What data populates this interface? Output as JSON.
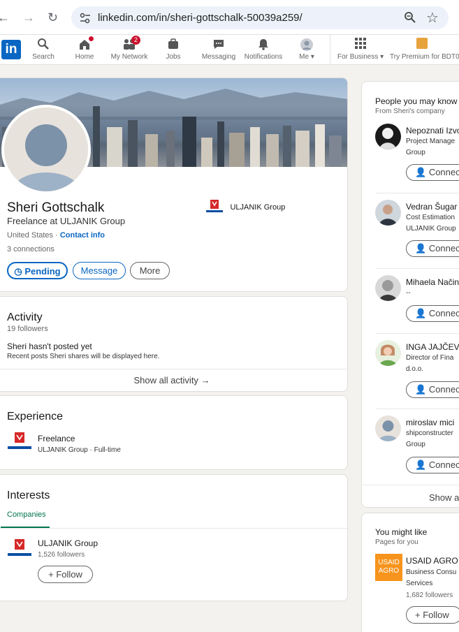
{
  "browser": {
    "url": "linkedin.com/in/sheri-gottschalk-50039a259/"
  },
  "nav": {
    "logo": "in",
    "items": [
      {
        "label": "Search",
        "icon": "search-icon"
      },
      {
        "label": "Home",
        "icon": "home-icon"
      },
      {
        "label": "My Network",
        "icon": "network-icon",
        "badge": "2"
      },
      {
        "label": "Jobs",
        "icon": "jobs-icon"
      },
      {
        "label": "Messaging",
        "icon": "messaging-icon"
      },
      {
        "label": "Notifications",
        "icon": "notifications-icon"
      },
      {
        "label": "Me",
        "icon": "me-avatar"
      },
      {
        "label": "For Business",
        "icon": "grid-icon"
      },
      {
        "label": "Try Premium for BDT0",
        "icon": "premium-icon"
      }
    ]
  },
  "profile": {
    "name": "Sheri Gottschalk",
    "headline": "Freelance at ULJANIK Group",
    "location": "United States",
    "contact_link": "Contact info",
    "connections": "3 connections",
    "company": "ULJANIK Group",
    "buttons": {
      "pending": "Pending",
      "message": "Message",
      "more": "More"
    }
  },
  "activity": {
    "title": "Activity",
    "followers": "19 followers",
    "empty_title": "Sheri hasn't posted yet",
    "empty_sub": "Recent posts Sheri shares will be displayed here.",
    "show_all": "Show all activity →"
  },
  "experience": {
    "title": "Experience",
    "items": [
      {
        "role": "Freelance",
        "company": "ULJANIK Group · Full-time"
      }
    ]
  },
  "interests": {
    "title": "Interests",
    "tab": "Companies",
    "items": [
      {
        "name": "ULJANIK Group",
        "followers": "1,526 followers",
        "button": "Follow"
      }
    ]
  },
  "pymk": {
    "title": "People you may know",
    "subtitle": "From Sheri's company",
    "connect_label": "Connect",
    "people": [
      {
        "name": "Nepoznati Izvo",
        "line1": "Project Manage",
        "line2": "Group"
      },
      {
        "name": "Vedran Šugar",
        "line1": "Cost Estimation",
        "line2": "ULJANIK Group"
      },
      {
        "name": "Mihaela Način",
        "line1": "--",
        "line2": ""
      },
      {
        "name": "INGA JAJČEV",
        "line1": "Director of Fina",
        "line2": "d.o.o."
      },
      {
        "name": "miroslav mici",
        "line1": "shipconstructer",
        "line2": "Group"
      }
    ],
    "show_all": "Show all"
  },
  "might_like": {
    "title": "You might like",
    "subtitle": "Pages for you",
    "page": {
      "logo_text": "USAID AGRO",
      "name": "USAID AGRO",
      "line1": "Business Consu",
      "line2": "Services",
      "followers": "1,682 followers",
      "button": "Follow"
    }
  },
  "colors": {
    "brand": "#0a66c2",
    "badge": "#cb112d",
    "follow_green": "#01754f",
    "usaid_orange": "#f7941d"
  }
}
